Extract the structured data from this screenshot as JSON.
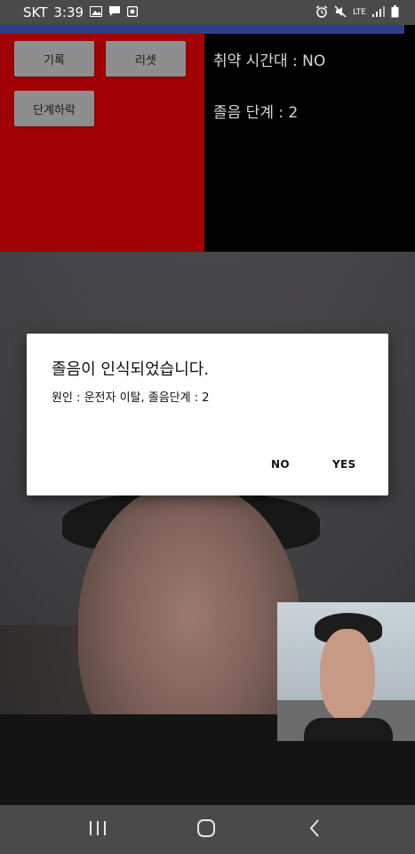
{
  "status_bar": {
    "carrier": "SKT",
    "time": "3:39",
    "network": "LTE"
  },
  "controls": {
    "record_label": "기록",
    "reset_label": "리셋",
    "level_down_label": "단계하락"
  },
  "info": {
    "vulnerable_time": "취약 시간대 : NO",
    "drowsy_level": "졸음 단계 : 2"
  },
  "dialog": {
    "title": "졸음이 인식되었습니다.",
    "message": "원인 : 운전자 이탈, 졸음단계 : 2",
    "no_label": "NO",
    "yes_label": "YES"
  },
  "nav": {
    "recents_icon": "recents-icon",
    "home_icon": "home-icon",
    "back_icon": "back-icon"
  },
  "colors": {
    "control_panel": "#a10004",
    "info_panel": "#000000",
    "accent_stripe": "#2d3f8a",
    "button": "#8e8e8e",
    "system_bar": "#4a4a4a"
  }
}
